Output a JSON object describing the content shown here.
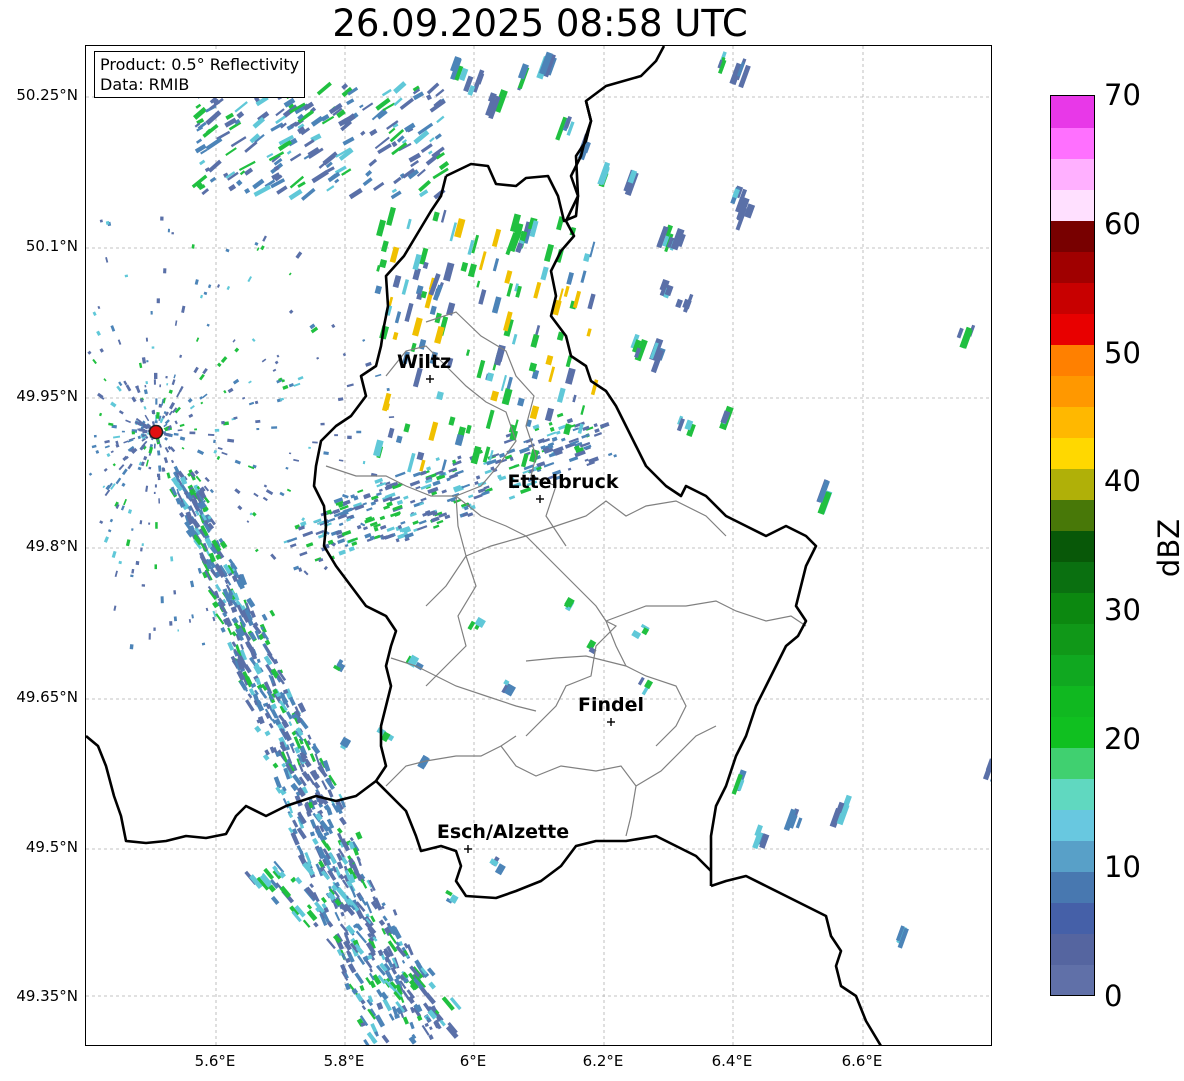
{
  "title": "26.09.2025 08:58 UTC",
  "info": {
    "product": "Product: 0.5° Reflectivity",
    "data": "Data: RMIB"
  },
  "axes": {
    "lat_ticks": [
      "50.25°N",
      "50.1°N",
      "49.95°N",
      "49.8°N",
      "49.65°N",
      "49.5°N",
      "49.35°N"
    ],
    "lon_ticks": [
      "5.6°E",
      "5.8°E",
      "6°E",
      "6.2°E",
      "6.4°E",
      "6.6°E"
    ]
  },
  "cities": [
    {
      "name": "Wiltz"
    },
    {
      "name": "Ettelbruck"
    },
    {
      "name": "Findel"
    },
    {
      "name": "Esch/Alzette"
    }
  ],
  "colorbar": {
    "label": "dBZ",
    "ticks": [
      "0",
      "10",
      "20",
      "30",
      "40",
      "50",
      "60",
      "70"
    ],
    "colors": [
      "#6070a8",
      "#5565a0",
      "#4560a8",
      "#4878b0",
      "#58a0c8",
      "#68c8e0",
      "#60d8c0",
      "#40d070",
      "#10c020",
      "#10b820",
      "#10a820",
      "#109818",
      "#0c8810",
      "#0a7010",
      "#085808",
      "#487808",
      "#b0b008",
      "#ffd800",
      "#ffb800",
      "#ff9800",
      "#ff8000",
      "#e80000",
      "#c80000",
      "#a00000",
      "#780000",
      "#ffe0ff",
      "#ffb0ff",
      "#ff70ff",
      "#e838e8"
    ],
    "cmin": 0,
    "cmax": 70
  },
  "radar_site": {
    "color": "#e01010"
  },
  "echo_colors": {
    "weak": "#5a70a8",
    "light": "#4c84b8",
    "cyan": "#60c8d8",
    "green": "#20c040",
    "yellow": "#f0c000"
  }
}
